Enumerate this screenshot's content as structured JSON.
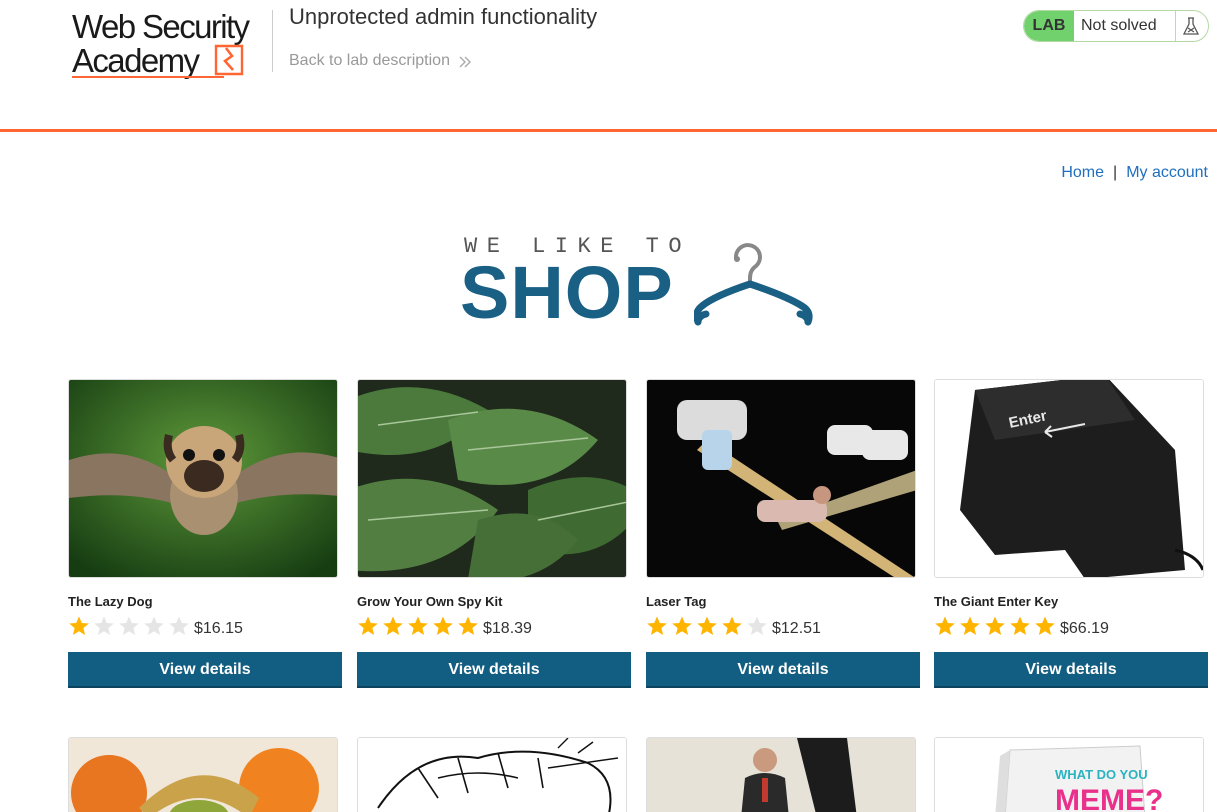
{
  "header": {
    "logo_line1": "Web Security",
    "logo_line2": "Academy",
    "lab_title": "Unprotected admin functionality",
    "back_link": "Back to lab description",
    "lab_badge": "LAB",
    "lab_status": "Not solved"
  },
  "nav": {
    "home": "Home",
    "separator": "|",
    "my_account": "My account"
  },
  "banner": {
    "tagline": "WE LIKE TO",
    "title": "SHOP"
  },
  "products": [
    {
      "name": "The Lazy Dog",
      "rating": 1,
      "price": "$16.15",
      "button": "View details",
      "image": "flying-pug-image"
    },
    {
      "name": "Grow Your Own Spy Kit",
      "rating": 5,
      "price": "$18.39",
      "button": "View details",
      "image": "leaves-image"
    },
    {
      "name": "Laser Tag",
      "rating": 4,
      "price": "$12.51",
      "button": "View details",
      "image": "laser-tag-image"
    },
    {
      "name": "The Giant Enter Key",
      "rating": 5,
      "price": "$66.19",
      "button": "View details",
      "image": "enter-key-image"
    }
  ],
  "row2_images": [
    "fruit-image",
    "sketch-image",
    "man-presenting-image",
    "what-do-you-meme-image"
  ],
  "row2_texts": {
    "meme_line1": "WHAT DO YOU",
    "meme_line2": "MEME?",
    "enter_key_label": "Enter"
  },
  "colors": {
    "accent": "#ff6633",
    "button": "#125d82",
    "link": "#1f6ebf",
    "star": "#ffb400",
    "star_empty": "#e5e5e5",
    "lab_green": "#70d16d"
  }
}
